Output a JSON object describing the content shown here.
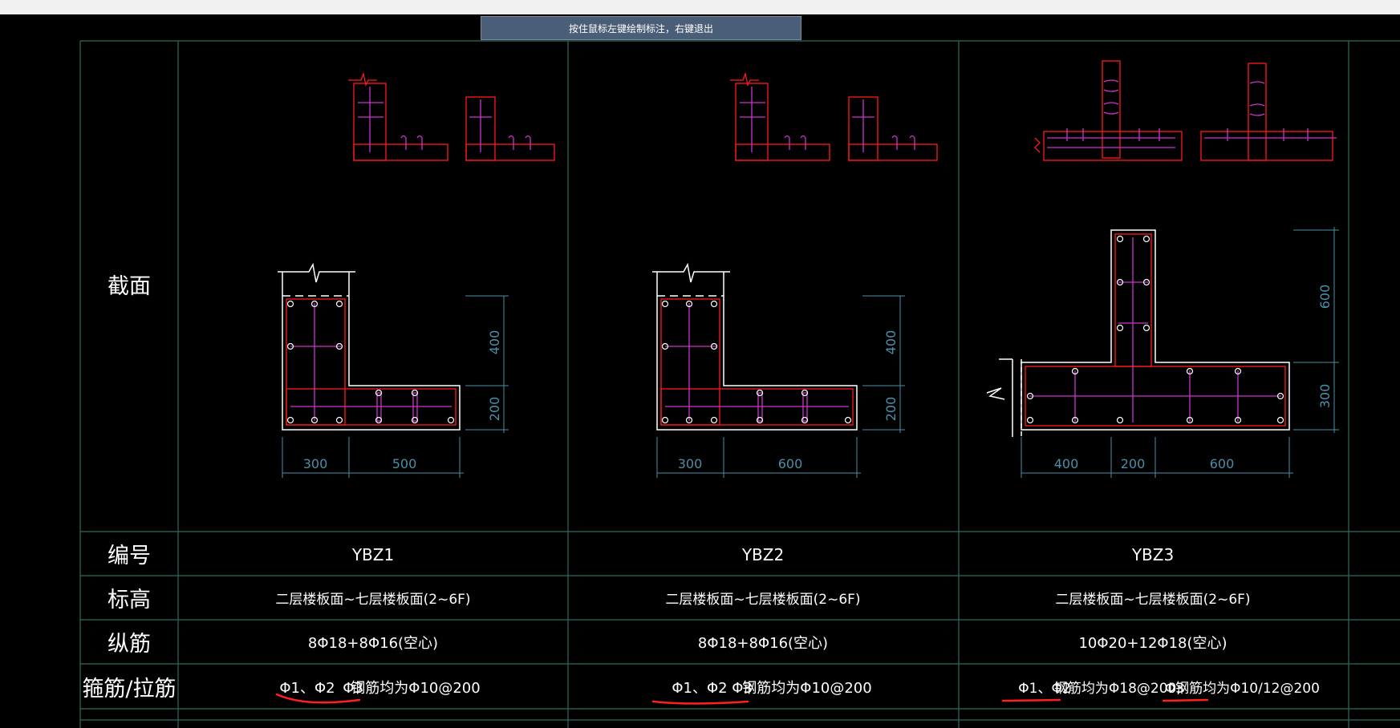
{
  "hint": "按住鼠标左键绘制标注，右键退出",
  "rows": {
    "section": "截面",
    "id": "编号",
    "elevation": "标高",
    "longitudinal": "纵筋",
    "stirrup": "箍筋/拉筋"
  },
  "columns": [
    {
      "id": "YBZ1",
      "elevation": "二层楼板面~七层楼板面(2~6F)",
      "longitudinal": "8Φ18+8Φ16(空心)",
      "stirrup_a": "Φ1、Φ2",
      "stirrup_b": "Φ3",
      "stirrup_c": "钢筋均为Φ10@200",
      "dims": {
        "v_top": "400",
        "v_bot": "200",
        "h_left": "300",
        "h_right": "500"
      }
    },
    {
      "id": "YBZ2",
      "elevation": "二层楼板面~七层楼板面(2~6F)",
      "longitudinal": "8Φ18+8Φ16(空心)",
      "stirrup_a": "Φ1、Φ2",
      "stirrup_b": "Φ3",
      "stirrup_c": "钢筋均为Φ10@200",
      "dims": {
        "v_top": "400",
        "v_bot": "200",
        "h_left": "300",
        "h_right": "600"
      }
    },
    {
      "id": "YBZ3",
      "elevation": "二层楼板面~七层楼板面(2~6F)",
      "longitudinal": "10Φ20+12Φ18(空心)",
      "stirrup_a": "Φ1、Φ2",
      "stirrup_b": "钢筋均为Φ18@200;",
      "stirrup_c": "Φ3",
      "stirrup_d": "钢筋均为Φ10/12@200",
      "dims": {
        "v_top": "600",
        "v_bot": "300",
        "h_left": "400",
        "h_mid": "200",
        "h_right": "600"
      }
    }
  ],
  "colors": {
    "grid": "#2e6b60",
    "concrete": "#ffffff",
    "rebar": "#ff1a1a",
    "tie": "#cc33cc",
    "dim": "#4a8fa8",
    "text": "#ffffff",
    "mark": "#ff2020"
  }
}
